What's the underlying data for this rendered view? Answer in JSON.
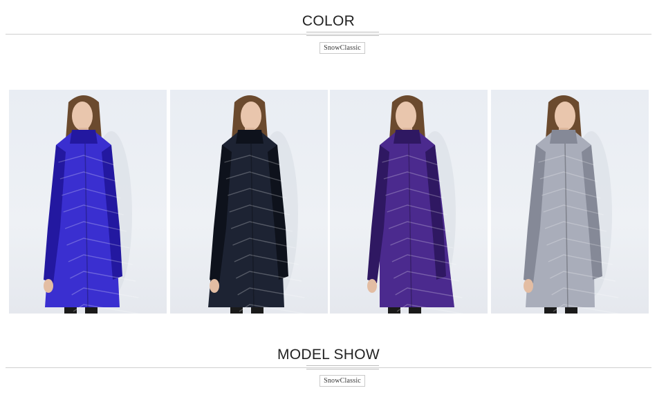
{
  "sections": {
    "color": {
      "title": "COLOR",
      "logo_text": "SnowClassic"
    },
    "model_show": {
      "title": "MODEL SHOW",
      "logo_text": "SnowClassic"
    }
  },
  "photos": [
    {
      "name": "royal-blue-coat",
      "coat_color": "#3a2fd0",
      "coat_shade": "#2318a0"
    },
    {
      "name": "navy-coat",
      "coat_color": "#1d2333",
      "coat_shade": "#0e121c"
    },
    {
      "name": "purple-coat",
      "coat_color": "#4b2a8e",
      "coat_shade": "#2f1862"
    },
    {
      "name": "gray-coat",
      "coat_color": "#a9adba",
      "coat_shade": "#858997"
    }
  ]
}
